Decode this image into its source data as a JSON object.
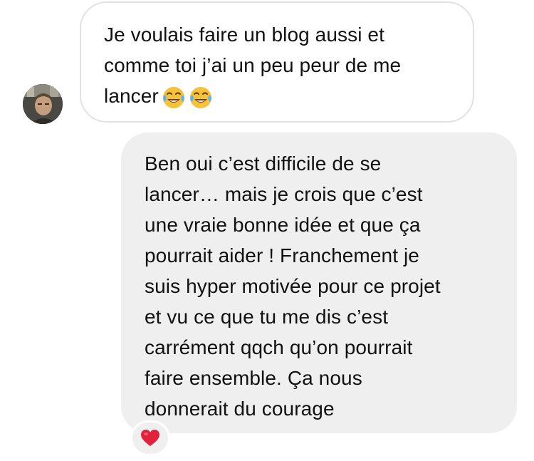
{
  "conversation": {
    "incoming_message": {
      "text": "Je voulais faire un blog aussi et\ncomme toi j’ai un peu peur de me\nlancer",
      "emojis": [
        "face-with-tears-of-joy-icon",
        "face-with-tears-of-joy-icon"
      ]
    },
    "reply_message": {
      "text": "Ben oui c’est difficile de se\nlancer… mais je crois que c’est\nune vraie bonne idée et que ça\npourrait aider ! Franchement je\nsuis hyper motivée pour ce projet\net vu ce que tu me dis c’est\ncarrément qqch qu’on pourrait\nfaire ensemble. Ça nous\ndonnerait du courage"
    },
    "reaction": {
      "icon": "red-heart-icon",
      "color": "#e0233a"
    }
  },
  "colors": {
    "incoming_bubble_border": "#e2e2e2",
    "reply_bubble_bg": "#efefef",
    "text": "#111111"
  }
}
